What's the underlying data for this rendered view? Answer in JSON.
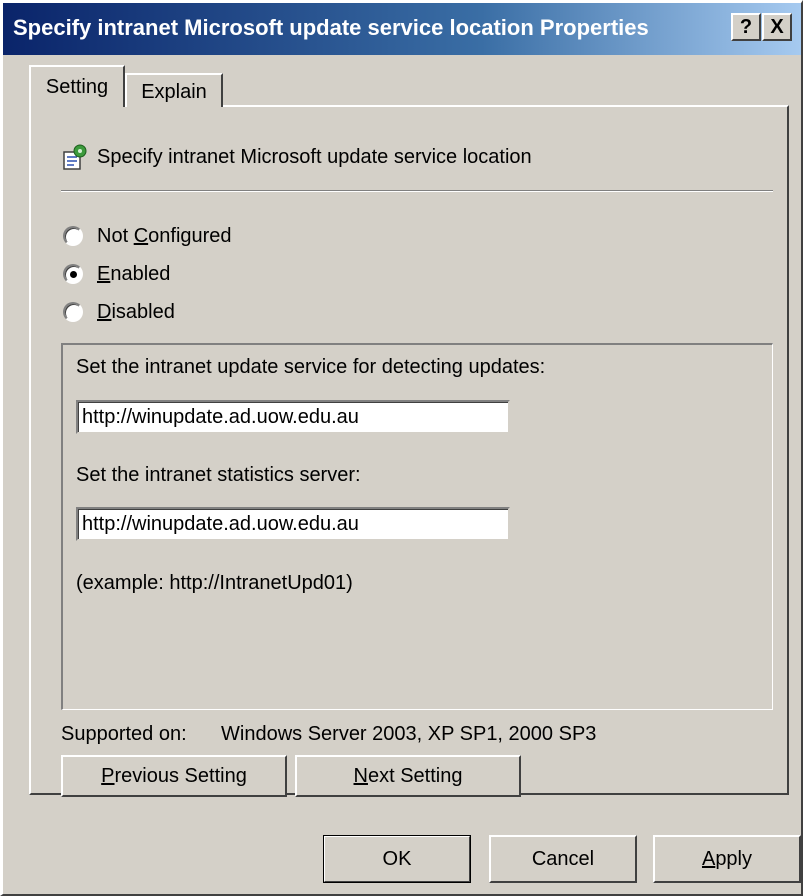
{
  "window": {
    "title": "Specify intranet Microsoft update service location Properties",
    "help_label": "?",
    "close_label": "X"
  },
  "tabs": [
    {
      "label": "Setting",
      "active": true
    },
    {
      "label": "Explain",
      "active": false
    }
  ],
  "policy": {
    "icon": "policy-setting-icon",
    "title": "Specify intranet Microsoft update service location"
  },
  "options": [
    {
      "pre": "Not ",
      "key": "C",
      "post": "onfigured",
      "checked": false
    },
    {
      "pre": "",
      "key": "E",
      "post": "nabled",
      "checked": true
    },
    {
      "pre": "",
      "key": "D",
      "post": "isabled",
      "checked": false
    }
  ],
  "options_panel": {
    "update_service_label": "Set the intranet update service for detecting updates:",
    "update_service_value": "http://winupdate.ad.uow.edu.au",
    "statistics_label": "Set the intranet statistics server:",
    "statistics_value": "http://winupdate.ad.uow.edu.au",
    "example": "(example: http://IntranetUpd01)"
  },
  "supported": {
    "label": "Supported on:",
    "value": "Windows Server 2003, XP SP1, 2000 SP3"
  },
  "nav": {
    "prev_key": "P",
    "prev_rest": "revious Setting",
    "next_key": "N",
    "next_rest": "ext Setting"
  },
  "footer": {
    "ok_label": "OK",
    "cancel_label": "Cancel",
    "apply_key": "A",
    "apply_rest": "pply"
  },
  "colors": {
    "face": "#d4d0c8",
    "title_start": "#0a246a",
    "title_end": "#a6caf0"
  }
}
